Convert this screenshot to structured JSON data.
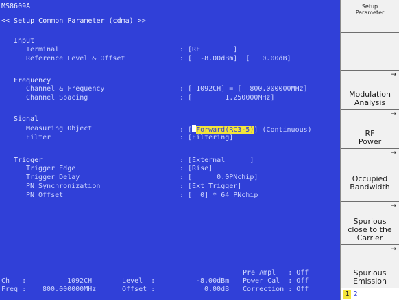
{
  "header": {
    "model": "MS8609A",
    "title": "<< Setup Common Parameter (cdma) >>"
  },
  "input": {
    "section": "Input",
    "terminal_label": "Terminal",
    "terminal_value": ": [RF        ]",
    "ref_label": "Reference Level & Offset",
    "ref_value": ": [  -8.00dBm]  [   0.00dB]"
  },
  "frequency": {
    "section": "Frequency",
    "channel_label": "Channel & Frequency",
    "channel_value": ": [ 1092CH] = [  800.000000MHz]",
    "spacing_label": "Channel Spacing",
    "spacing_value": ": [        1.250000MHz]"
  },
  "signal": {
    "section": "Signal",
    "object_label": "Measuring Object",
    "object_prefix": ": [",
    "object_highlight": "Forward(RC3-5)",
    "object_suffix": "] (Continuous)",
    "filter_label": "Filter",
    "filter_value": ": [Filtering]"
  },
  "trigger": {
    "section": "Trigger",
    "source_value": ": [External      ]",
    "edge_label": "Trigger Edge",
    "edge_value": ": [Rise]",
    "delay_label": "Trigger Delay",
    "delay_value": ": [      0.0PNchip]",
    "pn_sync_label": "PN Synchronization",
    "pn_sync_value": ": [Ext Trigger]",
    "pn_offset_label": "PN Offset",
    "pn_offset_value": ": [  0] * 64 PNchip"
  },
  "status": {
    "ch_label": "Ch   :",
    "ch_value": "1092CH",
    "freq_label": "Freq :",
    "freq_value": "800.000000MHz",
    "level_label": "Level  :",
    "level_value": "-8.00dBm",
    "offset_label": "Offset :",
    "offset_value": "0.00dB",
    "preampl": "Pre Ampl   : Off",
    "powercal": "Power Cal  : Off",
    "correction": "Correction : Off"
  },
  "softkeys": {
    "title_line1": "Setup",
    "title_line2": "Parameter",
    "modulation_line1": "Modulation",
    "modulation_line2": "Analysis",
    "rf_line1": "RF",
    "rf_line2": "Power",
    "occupied_line1": "Occupied",
    "occupied_line2": "Bandwidth",
    "spurious_close_line1": "Spurious",
    "spurious_close_line2": "close to the",
    "spurious_close_line3": "Carrier",
    "spurious_emission_line1": "Spurious",
    "spurious_emission_line2": "Emission",
    "arrow": "→",
    "page1": "1",
    "page2": "2"
  }
}
